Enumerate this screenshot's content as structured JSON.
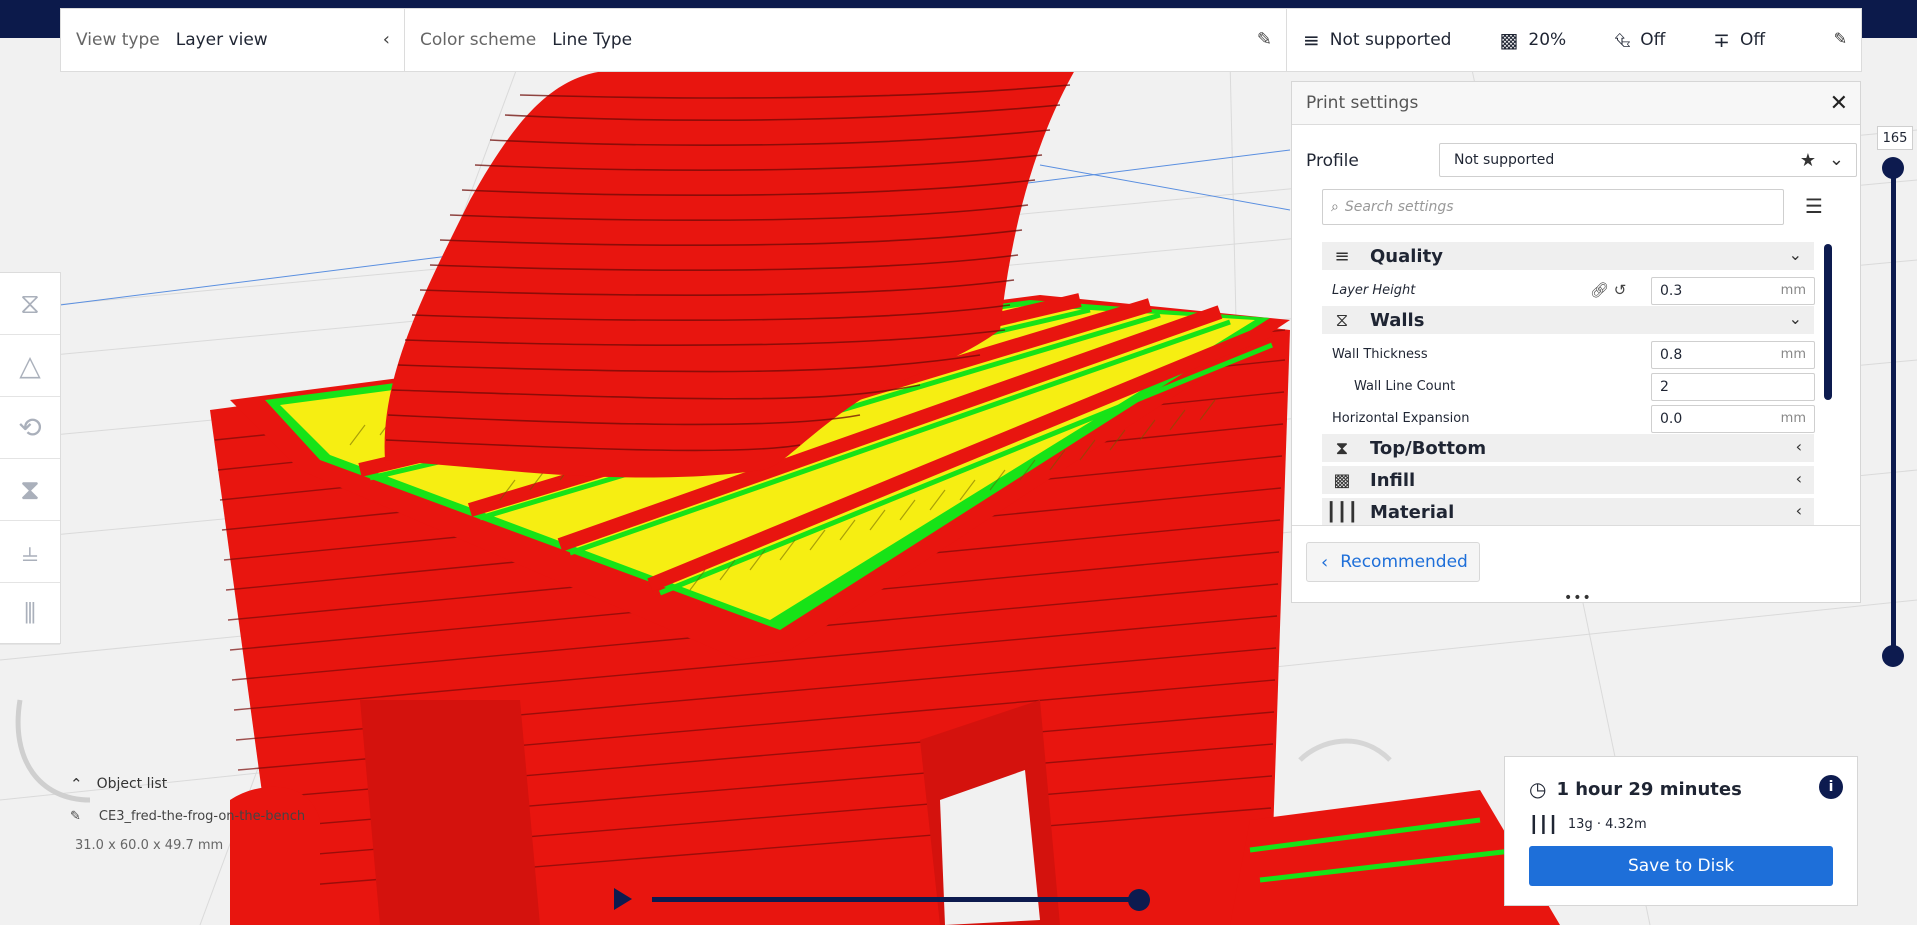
{
  "header": {
    "view_type_label": "View type",
    "view_type_value": "Layer view",
    "color_scheme_label": "Color scheme",
    "color_scheme_value": "Line Type",
    "profile_summary": "Not supported",
    "infill": "20%",
    "support": "Off",
    "adhesion": "Off"
  },
  "panel": {
    "title": "Print settings",
    "profile_label": "Profile",
    "profile_value": "Not supported",
    "search_placeholder": "Search settings",
    "categories": {
      "quality": "Quality",
      "walls": "Walls",
      "top_bottom": "Top/Bottom",
      "infill": "Infill",
      "material": "Material"
    },
    "settings": {
      "layer_height": {
        "label": "Layer Height",
        "value": "0.3",
        "unit": "mm"
      },
      "wall_thickness": {
        "label": "Wall Thickness",
        "value": "0.8",
        "unit": "mm"
      },
      "wall_line_count": {
        "label": "Wall Line Count",
        "value": "2"
      },
      "horizontal_expansion": {
        "label": "Horizontal Expansion",
        "value": "0.0",
        "unit": "mm"
      }
    },
    "recommended_label": "Recommended"
  },
  "layer_slider": {
    "current": "165"
  },
  "object_list": {
    "title": "Object list",
    "object_name": "CE3_fred-the-frog-on-the-bench",
    "dimensions": "31.0 x 60.0 x 49.7 mm"
  },
  "estimate": {
    "time": "1 hour 29 minutes",
    "material": "13g · 4.32m",
    "save_label": "Save to Disk"
  },
  "colors": {
    "accent": "#1e6fd9",
    "dark": "#0d1b4f",
    "wall_outer": "#e8150f",
    "wall_inner": "#17e317",
    "skin": "#f6ee12"
  }
}
